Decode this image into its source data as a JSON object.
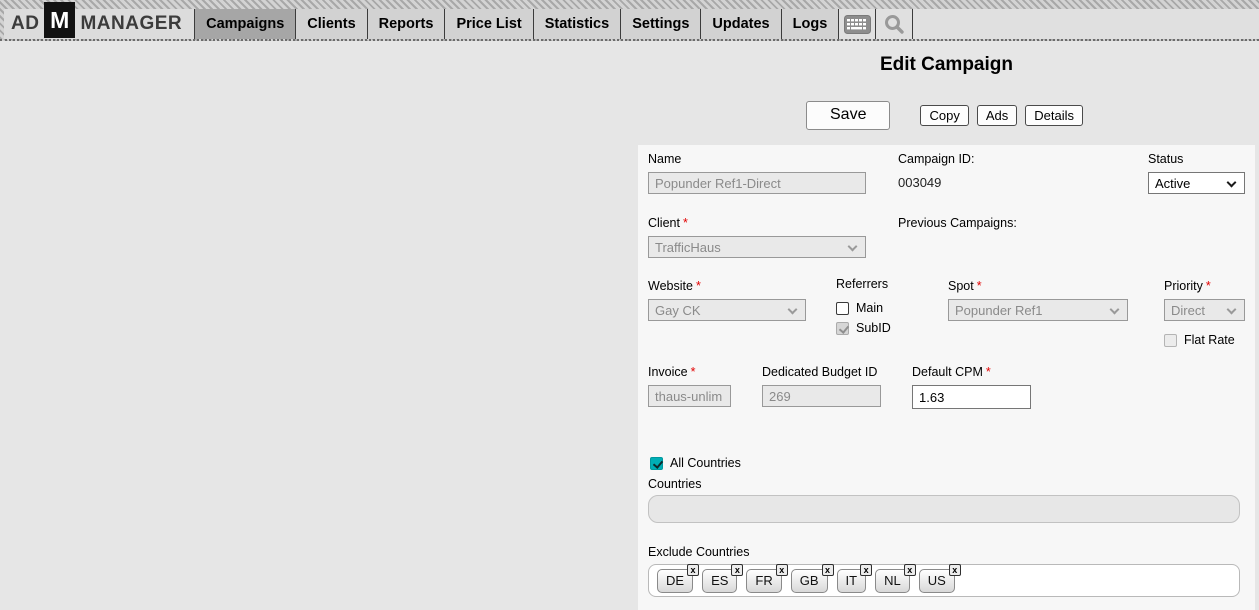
{
  "nav": {
    "logo": {
      "prefix": "AD",
      "m": "M",
      "suffix": "MANAGER"
    },
    "tabs": [
      {
        "label": "Campaigns",
        "active": true
      },
      {
        "label": "Clients",
        "active": false
      },
      {
        "label": "Reports",
        "active": false
      },
      {
        "label": "Price List",
        "active": false
      },
      {
        "label": "Statistics",
        "active": false
      },
      {
        "label": "Settings",
        "active": false
      },
      {
        "label": "Updates",
        "active": false
      },
      {
        "label": "Logs",
        "active": false
      }
    ]
  },
  "icons": {
    "keyboard": "keyboard-icon",
    "zoom": "zoom-icon",
    "remove": "x"
  },
  "page": {
    "title": "Edit Campaign",
    "actions": {
      "save": "Save",
      "copy": "Copy",
      "ads": "Ads",
      "details": "Details"
    }
  },
  "required_mark": "*",
  "form": {
    "name": {
      "label": "Name",
      "value": "Popunder Ref1-Direct"
    },
    "campaign_id": {
      "label": "Campaign ID:",
      "value": "003049"
    },
    "status": {
      "label": "Status",
      "value": "Active"
    },
    "client": {
      "label": "Client",
      "value": "TrafficHaus"
    },
    "previous_campaigns": {
      "label": "Previous Campaigns:"
    },
    "website": {
      "label": "Website",
      "value": "Gay CK"
    },
    "referrers": {
      "label": "Referrers",
      "main": {
        "label": "Main",
        "checked": false
      },
      "subid": {
        "label": "SubID",
        "checked": true
      }
    },
    "spot": {
      "label": "Spot",
      "value": "Popunder Ref1"
    },
    "priority": {
      "label": "Priority",
      "value": "Direct"
    },
    "flat_rate": {
      "label": "Flat Rate",
      "checked": false
    },
    "invoice": {
      "label": "Invoice",
      "value": "thaus-unlim"
    },
    "budget_id": {
      "label": "Dedicated Budget ID",
      "value": "269"
    },
    "default_cpm": {
      "label": "Default CPM",
      "value": "1.63"
    },
    "all_countries": {
      "label": "All Countries",
      "checked": true
    },
    "countries": {
      "label": "Countries",
      "value": ""
    },
    "exclude_countries": {
      "label": "Exclude Countries",
      "tags": [
        "DE",
        "ES",
        "FR",
        "GB",
        "IT",
        "NL",
        "US"
      ]
    }
  },
  "colors": {
    "accent_teal": "#00aeb5",
    "required_red": "#e20000",
    "panel_bg": "#f7f7f7",
    "page_bg": "#e6e6e6",
    "tab_active": "#a6a6a6"
  }
}
